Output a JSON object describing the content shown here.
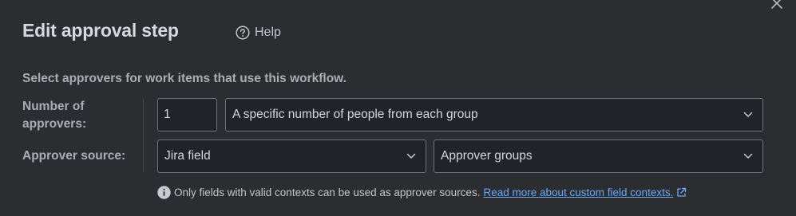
{
  "dialog": {
    "title": "Edit approval step",
    "help_label": "Help",
    "description": "Select approvers for work items that use this workflow."
  },
  "fields": {
    "number_of_approvers": {
      "label": "Number of approvers:",
      "value": "1",
      "mode": "A specific number of people from each group"
    },
    "approver_source": {
      "label": "Approver source:",
      "source": "Jira field",
      "field": "Approver groups"
    }
  },
  "info": {
    "text": "Only fields with valid contexts can be used as approver sources.",
    "link_text": "Read more about custom field contexts."
  },
  "icons": {
    "close": "close-icon",
    "help": "question-circle-icon",
    "chevron": "chevron-down-icon",
    "info": "info-icon",
    "external": "external-link-icon"
  },
  "colors": {
    "background": "#2c2d31",
    "input_background": "#22232a",
    "input_border": "#6f737a",
    "link": "#6aa8f5"
  }
}
